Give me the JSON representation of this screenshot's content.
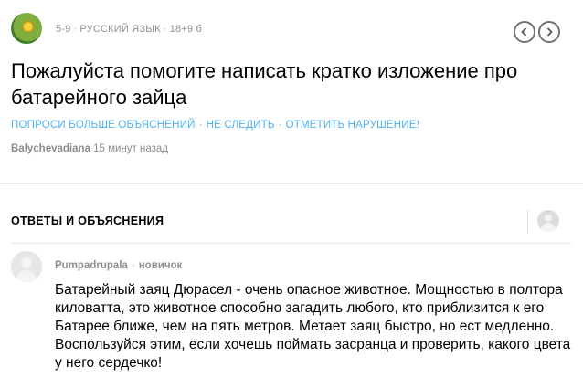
{
  "question": {
    "grade": "5-9",
    "subject": "РУССКИЙ ЯЗЫК",
    "points": "18+9 б",
    "title": "Пожалуйста помогите написать кратко изложение про батарейного зайца",
    "actions": {
      "ask_more": "ПОПРОСИ БОЛЬШЕ ОБЪЯСНЕНИЙ",
      "unfollow": "НЕ СЛЕДИТЬ",
      "report": "ОТМЕТИТЬ НАРУШЕНИЕ!"
    },
    "author": "Balychevadiana",
    "time": "15 минут назад"
  },
  "nav": {
    "prev_icon": "chevron-left-icon",
    "next_icon": "chevron-right-icon"
  },
  "answers": {
    "heading": "ОТВЕТЫ И ОБЪЯСНЕНИЯ",
    "items": [
      {
        "author": "Pumpadrupala",
        "rank": "новичок",
        "text": "Батарейный заяц Дюрасел - очень опасное животное. Мощностью в полтора киловатта, это животное способно загадить любого, кто приблизится к его Батарее ближе, чем на пять метров. Метает заяц быстро, но ест медленно. Воспользуйся этим, если хочешь поймать засранца и проверить, какого цвета у него сердечко!"
      }
    ]
  },
  "colors": {
    "accent": "#4fb3f6",
    "meta_gray": "#8f8f8f"
  }
}
